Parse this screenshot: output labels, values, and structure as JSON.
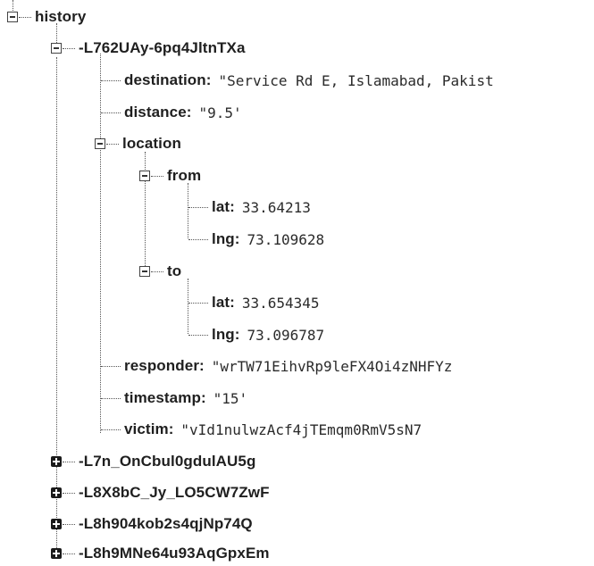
{
  "tree": {
    "root": {
      "key": "history"
    },
    "entry": {
      "key": "-L762UAy-6pq4JltnTXa",
      "destination": {
        "key": "destination",
        "value": "\"Service Rd E, Islamabad, Pakist"
      },
      "distance": {
        "key": "distance",
        "value": "\"9.5'"
      },
      "location": {
        "key": "location",
        "from": {
          "key": "from",
          "lat": {
            "key": "lat",
            "value": "33.64213"
          },
          "lng": {
            "key": "lng",
            "value": "73.109628"
          }
        },
        "to": {
          "key": "to",
          "lat": {
            "key": "lat",
            "value": "33.654345"
          },
          "lng": {
            "key": "lng",
            "value": "73.096787"
          }
        }
      },
      "responder": {
        "key": "responder",
        "value": "\"wrTW71EihvRp9leFX4Oi4zNHFYz"
      },
      "timestamp": {
        "key": "timestamp",
        "value": "\"15'"
      },
      "victim": {
        "key": "victim",
        "value": "\"vId1nulwzAcf4jTEmqm0RmV5sN7"
      }
    },
    "collapsed": [
      {
        "key": "-L7n_OnCbul0gdulAU5g"
      },
      {
        "key": "-L8X8bC_Jy_LO5CW7ZwF"
      },
      {
        "key": "-L8h904kob2s4qjNp74Q"
      },
      {
        "key": "-L8h9MNe64u93AqGpxEm"
      }
    ]
  }
}
